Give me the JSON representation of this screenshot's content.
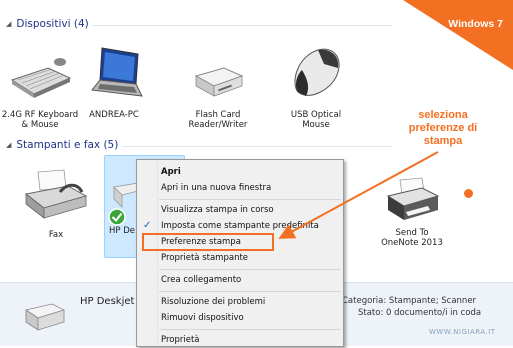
{
  "banner": {
    "text": "Windows 7"
  },
  "sections": {
    "devices": {
      "title": "Dispositivi (4)"
    },
    "printers": {
      "title": "Stampanti e fax (5)"
    }
  },
  "devices": [
    {
      "label_line1": "2.4G RF Keyboard",
      "label_line2": "& Mouse",
      "icon": "keyboard-icon"
    },
    {
      "label_line1": "ANDREA-PC",
      "label_line2": "",
      "icon": "laptop-icon"
    },
    {
      "label_line1": "Flash Card",
      "label_line2": "Reader/Writer",
      "icon": "card-reader-icon"
    },
    {
      "label_line1": "USB Optical",
      "label_line2": "Mouse",
      "icon": "mouse-icon"
    }
  ],
  "printers": [
    {
      "label_line1": "Fax",
      "label_line2": "",
      "icon": "fax-icon"
    },
    {
      "label_line1": "HP De",
      "label_line2": "",
      "icon": "printer-icon",
      "default": true
    },
    {
      "label_line1": "Send To",
      "label_line2": "OneNote 2013",
      "icon": "printer-icon"
    }
  ],
  "annotation": {
    "line1": "seleziona",
    "line2": "preferenze di",
    "line3": "stampa"
  },
  "context_menu": {
    "open": "Apri",
    "open_new_window": "Apri in una nuova finestra",
    "view_queue": "Visualizza stampa in corso",
    "set_default": "Imposta come stampante predefinita",
    "printing_preferences": "Preferenze stampa",
    "printer_properties": "Proprietà stampante",
    "create_shortcut": "Crea collegamento",
    "troubleshoot": "Risoluzione dei problemi",
    "remove_device": "Rimuovi dispositivo",
    "properties": "Proprietà"
  },
  "details": {
    "name": "HP Deskjet F4",
    "category": "Categoria: Stampante; Scanner",
    "status": "Stato: 0 documento/i in coda"
  },
  "watermark": "WWW.NIGIARA.IT",
  "colors": {
    "accent": "#f36f21",
    "selection": "#cde8ff",
    "heading": "#1e3287"
  }
}
